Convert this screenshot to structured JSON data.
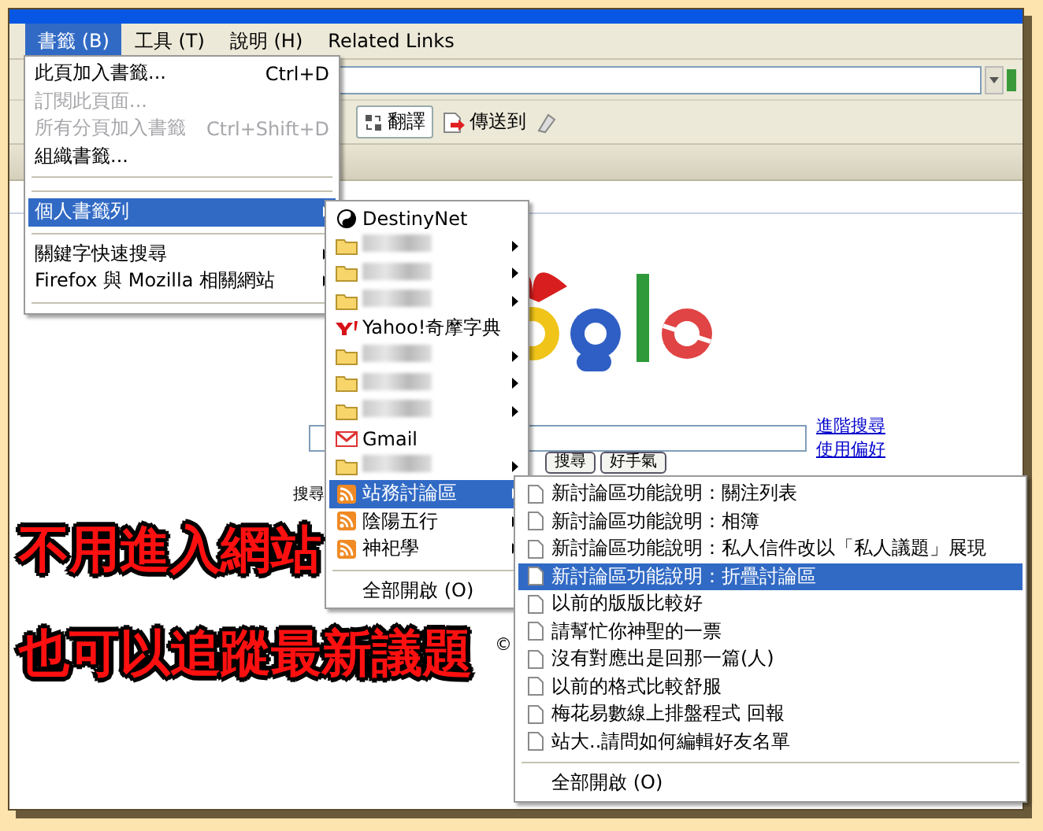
{
  "menu_bar": [
    {
      "label": "書籤 (B)",
      "selected": true
    },
    {
      "label": "工具 (T)",
      "selected": false
    },
    {
      "label": "說明 (H)",
      "selected": false
    },
    {
      "label": "Related Links",
      "selected": false
    }
  ],
  "toolbar": {
    "translate": "翻譯",
    "send_to": "傳送到"
  },
  "page": {
    "search_field_label": "搜尋",
    "links": [
      "進階搜尋",
      "使用偏好"
    ],
    "buttons": [
      "搜尋",
      "好手氣"
    ],
    "copyright": "©"
  },
  "overlay_text": [
    "不用進入網站",
    "也可以追蹤最新議題"
  ],
  "bookmarks_menu": [
    {
      "kind": "command",
      "label": "此頁加入書籤...",
      "shortcut": "Ctrl+D",
      "disabled": false,
      "selected": false,
      "has_submenu": false
    },
    {
      "kind": "command",
      "label": "訂閱此頁面...",
      "disabled": true,
      "selected": false,
      "has_submenu": false
    },
    {
      "kind": "command",
      "label": "所有分頁加入書籤",
      "shortcut": "Ctrl+Shift+D",
      "disabled": true,
      "selected": false,
      "has_submenu": false
    },
    {
      "kind": "command",
      "label": "組織書籤...",
      "disabled": false,
      "selected": false,
      "has_submenu": false
    },
    {
      "kind": "separator"
    },
    {
      "kind": "separator"
    },
    {
      "kind": "folder",
      "label": "個人書籤列",
      "disabled": false,
      "selected": true,
      "has_submenu": true
    },
    {
      "kind": "separator"
    },
    {
      "kind": "folder",
      "label": "關鍵字快速搜尋",
      "disabled": false,
      "selected": false,
      "has_submenu": true
    },
    {
      "kind": "folder",
      "label": "Firefox 與 Mozilla 相關網站",
      "disabled": false,
      "selected": false,
      "has_submenu": true
    },
    {
      "kind": "separator"
    }
  ],
  "toolbar_menu": [
    {
      "kind": "yinyang",
      "label": "DestinyNet",
      "selected": false,
      "has_submenu": false
    },
    {
      "kind": "blurred",
      "selected": false,
      "has_submenu": true
    },
    {
      "kind": "blurred",
      "selected": false,
      "has_submenu": true
    },
    {
      "kind": "blurred",
      "selected": false,
      "has_submenu": true
    },
    {
      "kind": "yahoo",
      "label": "Yahoo!奇摩字典",
      "selected": false,
      "has_submenu": false
    },
    {
      "kind": "blurred",
      "selected": false,
      "has_submenu": true
    },
    {
      "kind": "blurred",
      "selected": false,
      "has_submenu": true
    },
    {
      "kind": "blurred",
      "selected": false,
      "has_submenu": true
    },
    {
      "kind": "gmail",
      "label": "Gmail",
      "selected": false,
      "has_submenu": false
    },
    {
      "kind": "blurred",
      "selected": false,
      "has_submenu": true
    },
    {
      "kind": "rss",
      "label": "站務討論區",
      "selected": true,
      "has_submenu": true
    },
    {
      "kind": "rss",
      "label": "陰陽五行",
      "selected": false,
      "has_submenu": true
    },
    {
      "kind": "rss",
      "label": "神祀學",
      "selected": false,
      "has_submenu": true
    },
    {
      "kind": "separator"
    },
    {
      "kind": "command",
      "label": "全部開啟 (O)",
      "selected": false,
      "has_submenu": false
    }
  ],
  "feed_menu": [
    {
      "kind": "page",
      "label": "新討論區功能說明：關注列表",
      "selected": false
    },
    {
      "kind": "page",
      "label": "新討論區功能說明：相簿",
      "selected": false
    },
    {
      "kind": "page",
      "label": "新討論區功能說明：私人信件改以「私人議題」展現",
      "selected": false
    },
    {
      "kind": "page",
      "label": "新討論區功能說明：折疊討論區",
      "selected": true
    },
    {
      "kind": "page",
      "label": "以前的版版比較好",
      "selected": false
    },
    {
      "kind": "page",
      "label": "請幫忙你神聖的一票",
      "selected": false
    },
    {
      "kind": "page",
      "label": "沒有對應出是回那一篇(人)",
      "selected": false
    },
    {
      "kind": "page",
      "label": "以前的格式比較舒服",
      "selected": false
    },
    {
      "kind": "page",
      "label": "梅花易數線上排盤程式 回報",
      "selected": false
    },
    {
      "kind": "page",
      "label": "站大..請問如何編輯好友名單",
      "selected": false
    },
    {
      "kind": "separator"
    },
    {
      "kind": "command",
      "label": "全部開啟 (O)",
      "selected": false
    }
  ]
}
